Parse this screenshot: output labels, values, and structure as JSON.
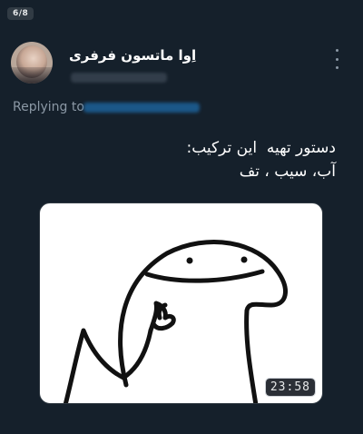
{
  "viewer": {
    "counter": "6/8"
  },
  "tweet": {
    "display_name": "اِوا ماتسون فرفری",
    "replying_label": "Replying to",
    "text_lines": [
      "دستور تهیه  این ترکیب:",
      "آب، سیب ، تف"
    ],
    "media": {
      "timestamp": "23:58",
      "icon": "ok-hand-meme-drawing"
    }
  },
  "icons": {
    "more": "more-vertical-icon"
  },
  "colors": {
    "background": "#15202b",
    "secondary_text": "#8b98a5",
    "link": "#1d9bf0"
  }
}
